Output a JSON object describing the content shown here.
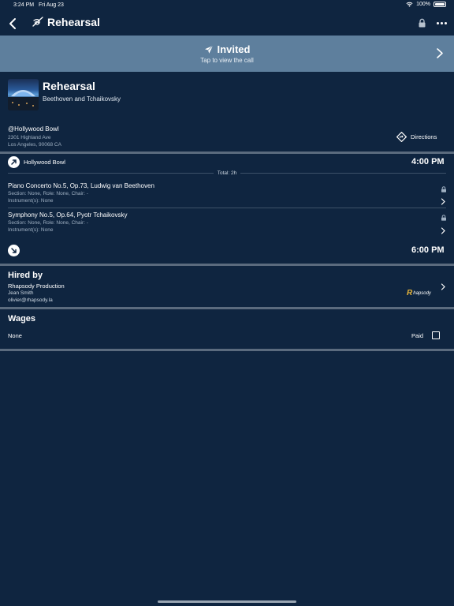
{
  "status_bar": {
    "time": "3:24 PM",
    "date": "Fri Aug 23",
    "battery": "100%"
  },
  "nav": {
    "title": "Rehearsal"
  },
  "banner": {
    "title": "Invited",
    "subtitle": "Tap to view the call"
  },
  "event": {
    "title": "Rehearsal",
    "subtitle": "Beethoven and Tchaikovsky"
  },
  "venue": {
    "name": "@Hollywood Bowl",
    "address_line1": "2301 Highland Ave",
    "address_line2": "Los Angeles, 90068 CA",
    "directions_label": "Directions"
  },
  "schedule": {
    "start_venue": "Hollywood Bowl",
    "start_time": "4:00 PM",
    "total": "Total: 2h",
    "end_time": "6:00 PM",
    "pieces": [
      {
        "title": "Piano Concerto No.5, Op.73,  Ludwig van Beethoven",
        "section": "Section: None, Role: None, Chair: -",
        "instruments": "Instrument(s): None"
      },
      {
        "title": "Symphony No.5, Op.64,  Pyotr Tchaikovsky",
        "section": "Section: None, Role: None, Chair: -",
        "instruments": "Instrument(s): None"
      }
    ]
  },
  "hired_by": {
    "heading": "Hired by",
    "company": "Rhapsody Production",
    "contact": "Jean Smith",
    "email": "olivier@rhapsody.la",
    "logo_text": "hapsody"
  },
  "wages": {
    "heading": "Wages",
    "value": "None",
    "paid_label": "Paid",
    "paid": false
  },
  "colors": {
    "background": "#0f2540",
    "banner": "#5e7f9d",
    "divider": "#5b6b7e",
    "logo_accent": "#e6b43a"
  }
}
